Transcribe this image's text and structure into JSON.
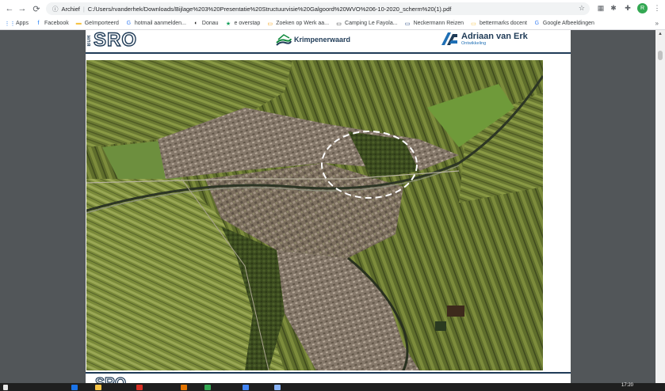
{
  "browser": {
    "nav": {
      "back": "←",
      "forward": "→",
      "reload": "⟳"
    },
    "address": {
      "security_label": "Archief",
      "url": "C:/Users/rvanderhek/Downloads/Bijlage%203%20Presentatie%20Structuurvisie%20Galgoord%20WVO%206-10-2020_scherm%20(1).pdf"
    },
    "profile_initial": "R",
    "bookmarks": [
      {
        "label": "Apps",
        "icon": "apps-grid-icon",
        "color": "#1a73e8"
      },
      {
        "label": "Facebook",
        "icon": "facebook-icon",
        "color": "#1877f2"
      },
      {
        "label": "Geïmporteerd",
        "icon": "folder-icon",
        "color": "#f6c344"
      },
      {
        "label": "hotmail aanmelden...",
        "icon": "google-icon",
        "color": "#4285f4"
      },
      {
        "label": "Donau",
        "icon": "globe-icon",
        "color": "#202124"
      },
      {
        "label": "e overstap",
        "icon": "star-icon",
        "color": "#0f9d58"
      },
      {
        "label": "Zoeken op Werk aa...",
        "icon": "page-icon",
        "color": "#f29900"
      },
      {
        "label": "Camping Le Fayola...",
        "icon": "page-icon",
        "color": "#202124"
      },
      {
        "label": "Neckermann Reizen",
        "icon": "page-icon",
        "color": "#1a3d7c"
      },
      {
        "label": "bettermarks docent",
        "icon": "page-icon",
        "color": "#f6c344"
      },
      {
        "label": "Google Afbeeldingen",
        "icon": "google-icon",
        "color": "#4285f4"
      }
    ]
  },
  "document": {
    "header": {
      "bur_label": "BUR",
      "sro_label": "SRO",
      "krimpen_label": "Krimpenerwaard",
      "ave_title": "Adriaan van Erk",
      "ave_subtitle": "Ontwikkeling"
    },
    "footer": {
      "bur_label": "BUR",
      "sro_label": "SRO"
    }
  },
  "taskbar": {
    "clock": "17:20"
  }
}
